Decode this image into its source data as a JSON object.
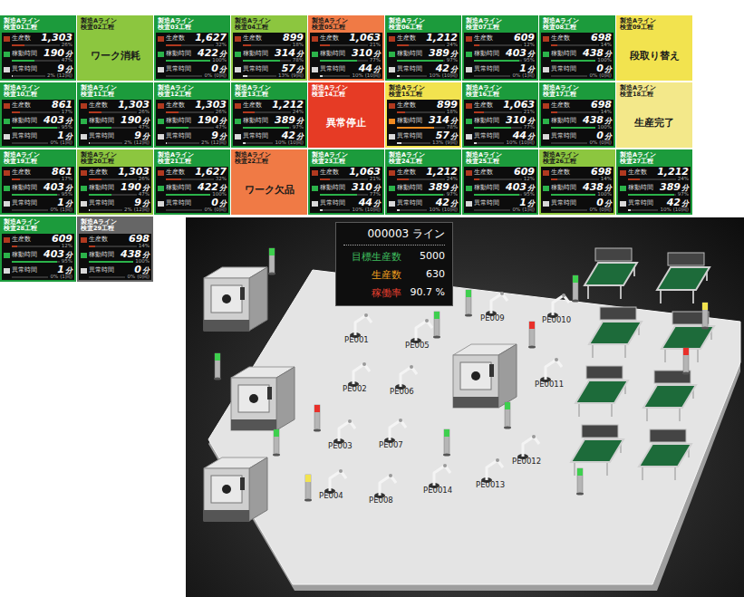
{
  "dashboard": {
    "tiles": [
      {
        "line": "製造Aライン",
        "process": "検査01工程",
        "color": "#1c9b3c",
        "kind": "metrics",
        "rows": [
          {
            "label": "生産数",
            "value": "1,303",
            "pct": "26%",
            "level": 0.26,
            "color": "#b0391f"
          },
          {
            "label": "稼動時間",
            "value": "190",
            "unit": "分",
            "pct": "47%",
            "level": 0.47,
            "color": "#2bb34a"
          },
          {
            "label": "異常時間",
            "value": "9",
            "unit": "分",
            "pct": "2%",
            "level": 0.02,
            "color": "#d8d8d8",
            "count": "(12回)"
          }
        ]
      },
      {
        "line": "製造Aライン",
        "process": "検査02工程",
        "color": "#8cc63f",
        "kind": "status",
        "status": "ワーク消耗"
      },
      {
        "line": "製造Aライン",
        "process": "検査03工程",
        "color": "#1c9b3c",
        "kind": "metrics",
        "rows": [
          {
            "label": "生産数",
            "value": "1,627",
            "pct": "32%",
            "level": 0.32,
            "color": "#b0391f"
          },
          {
            "label": "稼動時間",
            "value": "422",
            "unit": "分",
            "pct": "100%",
            "level": 1,
            "color": "#2bb34a"
          },
          {
            "label": "異常時間",
            "value": "0",
            "unit": "分",
            "pct": "0%",
            "level": 0,
            "color": "#d8d8d8",
            "count": "(0回)"
          }
        ]
      },
      {
        "line": "製造Aライン",
        "process": "検査04工程",
        "color": "#8cc63f",
        "kind": "metrics",
        "rows": [
          {
            "label": "生産数",
            "value": "899",
            "pct": "18%",
            "level": 0.18,
            "color": "#b0391f"
          },
          {
            "label": "稼動時間",
            "value": "314",
            "unit": "分",
            "pct": "78%",
            "level": 0.78,
            "color": "#2bb34a"
          },
          {
            "label": "異常時間",
            "value": "57",
            "unit": "分",
            "pct": "13%",
            "level": 0.13,
            "color": "#d8d8d8",
            "count": "(9回)"
          }
        ]
      },
      {
        "line": "製造Aライン",
        "process": "検査05工程",
        "color": "#f07a45",
        "kind": "metrics",
        "rows": [
          {
            "label": "生産数",
            "value": "1,063",
            "pct": "21%",
            "level": 0.21,
            "color": "#b0391f"
          },
          {
            "label": "稼動時間",
            "value": "310",
            "unit": "分",
            "pct": "77%",
            "level": 0.77,
            "color": "#2bb34a"
          },
          {
            "label": "異常時間",
            "value": "44",
            "unit": "分",
            "pct": "10%",
            "level": 0.1,
            "color": "#d8d8d8",
            "count": "(10回)"
          }
        ]
      },
      {
        "line": "製造Aライン",
        "process": "検査06工程",
        "color": "#1c9b3c",
        "kind": "metrics",
        "rows": [
          {
            "label": "生産数",
            "value": "1,212",
            "pct": "24%",
            "level": 0.24,
            "color": "#b0391f"
          },
          {
            "label": "稼動時間",
            "value": "389",
            "unit": "分",
            "pct": "97%",
            "level": 0.97,
            "color": "#2bb34a"
          },
          {
            "label": "異常時間",
            "value": "42",
            "unit": "分",
            "pct": "10%",
            "level": 0.1,
            "color": "#d8d8d8",
            "count": "(10回)"
          }
        ]
      },
      {
        "line": "製造Aライン",
        "process": "検査07工程",
        "color": "#1c9b3c",
        "kind": "metrics",
        "rows": [
          {
            "label": "生産数",
            "value": "609",
            "pct": "12%",
            "level": 0.12,
            "color": "#b0391f"
          },
          {
            "label": "稼動時間",
            "value": "403",
            "unit": "分",
            "pct": "95%",
            "level": 0.95,
            "color": "#2bb34a"
          },
          {
            "label": "異常時間",
            "value": "1",
            "unit": "分",
            "pct": "0%",
            "level": 0,
            "color": "#d8d8d8",
            "count": "(1回)"
          }
        ]
      },
      {
        "line": "製造Aライン",
        "process": "検査08工程",
        "color": "#1c9b3c",
        "kind": "metrics",
        "rows": [
          {
            "label": "生産数",
            "value": "698",
            "pct": "14%",
            "level": 0.14,
            "color": "#b0391f"
          },
          {
            "label": "稼動時間",
            "value": "438",
            "unit": "分",
            "pct": "100%",
            "level": 1,
            "color": "#2bb34a"
          },
          {
            "label": "異常時間",
            "value": "0",
            "unit": "分",
            "pct": "0%",
            "level": 0,
            "color": "#d8d8d8",
            "count": "(0回)"
          }
        ]
      },
      {
        "line": "製造Aライン",
        "process": "検査09工程",
        "color": "#f2e34f",
        "kind": "status",
        "status": "段取り替え"
      },
      {
        "line": "製造Aライン",
        "process": "検査10工程",
        "color": "#1c9b3c",
        "kind": "metrics",
        "rows": [
          {
            "label": "生産数",
            "value": "861",
            "pct": "17%",
            "level": 0.17,
            "color": "#b0391f"
          },
          {
            "label": "稼動時間",
            "value": "403",
            "unit": "分",
            "pct": "95%",
            "level": 0.95,
            "color": "#2bb34a"
          },
          {
            "label": "異常時間",
            "value": "1",
            "unit": "分",
            "pct": "0%",
            "level": 0,
            "color": "#d8d8d8",
            "count": "(1回)"
          }
        ]
      },
      {
        "line": "製造Aライン",
        "process": "検査11工程",
        "color": "#1c9b3c",
        "kind": "metrics",
        "rows": [
          {
            "label": "生産数",
            "value": "1,303",
            "pct": "26%",
            "level": 0.26,
            "color": "#b0391f"
          },
          {
            "label": "稼動時間",
            "value": "190",
            "unit": "分",
            "pct": "47%",
            "level": 0.47,
            "color": "#2bb34a"
          },
          {
            "label": "異常時間",
            "value": "9",
            "unit": "分",
            "pct": "2%",
            "level": 0.02,
            "color": "#d8d8d8",
            "count": "(12回)"
          }
        ]
      },
      {
        "line": "製造Aライン",
        "process": "検査12工程",
        "color": "#1c9b3c",
        "kind": "metrics",
        "rows": [
          {
            "label": "生産数",
            "value": "1,303",
            "pct": "26%",
            "level": 0.26,
            "color": "#b0391f"
          },
          {
            "label": "稼動時間",
            "value": "190",
            "unit": "分",
            "pct": "47%",
            "level": 0.47,
            "color": "#2bb34a"
          },
          {
            "label": "異常時間",
            "value": "9",
            "unit": "分",
            "pct": "2%",
            "level": 0.02,
            "color": "#d8d8d8",
            "count": "(12回)"
          }
        ]
      },
      {
        "line": "製造Aライン",
        "process": "検査13工程",
        "color": "#1c9b3c",
        "kind": "metrics",
        "rows": [
          {
            "label": "生産数",
            "value": "1,212",
            "pct": "24%",
            "level": 0.24,
            "color": "#b0391f"
          },
          {
            "label": "稼動時間",
            "value": "389",
            "unit": "分",
            "pct": "97%",
            "level": 0.97,
            "color": "#2bb34a"
          },
          {
            "label": "異常時間",
            "value": "42",
            "unit": "分",
            "pct": "10%",
            "level": 0.1,
            "color": "#d8d8d8",
            "count": "(10回)"
          }
        ]
      },
      {
        "line": "製造Aライン",
        "process": "検査14工程",
        "color": "#e63b25",
        "kind": "status",
        "status": "異常停止"
      },
      {
        "line": "製造Aライン",
        "process": "検査15工程",
        "color": "#f2e34f",
        "kind": "metrics",
        "rows": [
          {
            "label": "生産数",
            "value": "899",
            "pct": "18%",
            "level": 0.18,
            "color": "#b0391f"
          },
          {
            "label": "稼動時間",
            "value": "314",
            "unit": "分",
            "pct": "78%",
            "level": 0.78,
            "color": "#f08a20"
          },
          {
            "label": "異常時間",
            "value": "57",
            "unit": "分",
            "pct": "13%",
            "level": 0.13,
            "color": "#d8d8d8",
            "count": "(9回)"
          }
        ]
      },
      {
        "line": "製造Aライン",
        "process": "検査16工程",
        "color": "#1c9b3c",
        "kind": "metrics",
        "rows": [
          {
            "label": "生産数",
            "value": "1,063",
            "pct": "21%",
            "level": 0.21,
            "color": "#b0391f"
          },
          {
            "label": "稼動時間",
            "value": "310",
            "unit": "分",
            "pct": "77%",
            "level": 0.77,
            "color": "#2bb34a"
          },
          {
            "label": "異常時間",
            "value": "44",
            "unit": "分",
            "pct": "10%",
            "level": 0.1,
            "color": "#d8d8d8",
            "count": "(10回)"
          }
        ]
      },
      {
        "line": "製造Aライン",
        "process": "検査17工程",
        "color": "#1c9b3c",
        "kind": "metrics",
        "rows": [
          {
            "label": "生産数",
            "value": "698",
            "pct": "14%",
            "level": 0.14,
            "color": "#b0391f"
          },
          {
            "label": "稼動時間",
            "value": "438",
            "unit": "分",
            "pct": "100%",
            "level": 1,
            "color": "#2bb34a"
          },
          {
            "label": "異常時間",
            "value": "0",
            "unit": "分",
            "pct": "0%",
            "level": 0,
            "color": "#d8d8d8",
            "count": "(0回)"
          }
        ]
      },
      {
        "line": "製造Aライン",
        "process": "検査18工程",
        "color": "#f3e88a",
        "kind": "status",
        "status": "生産完了"
      },
      {
        "line": "製造Aライン",
        "process": "検査19工程",
        "color": "#1c9b3c",
        "kind": "metrics",
        "rows": [
          {
            "label": "生産数",
            "value": "861",
            "pct": "17%",
            "level": 0.17,
            "color": "#b0391f"
          },
          {
            "label": "稼動時間",
            "value": "403",
            "unit": "分",
            "pct": "95%",
            "level": 0.95,
            "color": "#2bb34a"
          },
          {
            "label": "異常時間",
            "value": "1",
            "unit": "分",
            "pct": "0%",
            "level": 0,
            "color": "#d8d8d8",
            "count": "(1回)"
          }
        ]
      },
      {
        "line": "製造Aライン",
        "process": "検査20工程",
        "color": "#8cc63f",
        "kind": "metrics",
        "rows": [
          {
            "label": "生産数",
            "value": "1,303",
            "pct": "26%",
            "level": 0.26,
            "color": "#b0391f"
          },
          {
            "label": "稼動時間",
            "value": "190",
            "unit": "分",
            "pct": "47%",
            "level": 0.47,
            "color": "#2bb34a"
          },
          {
            "label": "異常時間",
            "value": "9",
            "unit": "分",
            "pct": "2%",
            "level": 0.02,
            "color": "#d8d8d8",
            "count": "(12回)"
          }
        ]
      },
      {
        "line": "製造Aライン",
        "process": "検査21工程",
        "color": "#1c9b3c",
        "kind": "metrics",
        "rows": [
          {
            "label": "生産数",
            "value": "1,627",
            "pct": "32%",
            "level": 0.32,
            "color": "#b0391f"
          },
          {
            "label": "稼動時間",
            "value": "422",
            "unit": "分",
            "pct": "100%",
            "level": 1,
            "color": "#2bb34a"
          },
          {
            "label": "異常時間",
            "value": "0",
            "unit": "分",
            "pct": "0%",
            "level": 0,
            "color": "#d8d8d8",
            "count": "(0回)"
          }
        ]
      },
      {
        "line": "製造Aライン",
        "process": "検査22工程",
        "color": "#f07a45",
        "kind": "status",
        "status": "ワーク欠品"
      },
      {
        "line": "製造Aライン",
        "process": "検査23工程",
        "color": "#1c9b3c",
        "kind": "metrics",
        "rows": [
          {
            "label": "生産数",
            "value": "1,063",
            "pct": "21%",
            "level": 0.21,
            "color": "#b0391f"
          },
          {
            "label": "稼動時間",
            "value": "310",
            "unit": "分",
            "pct": "77%",
            "level": 0.77,
            "color": "#2bb34a"
          },
          {
            "label": "異常時間",
            "value": "44",
            "unit": "分",
            "pct": "10%",
            "level": 0.1,
            "color": "#d8d8d8",
            "count": "(10回)"
          }
        ]
      },
      {
        "line": "製造Aライン",
        "process": "検査24工程",
        "color": "#1c9b3c",
        "kind": "metrics",
        "rows": [
          {
            "label": "生産数",
            "value": "1,212",
            "pct": "24%",
            "level": 0.24,
            "color": "#b0391f"
          },
          {
            "label": "稼動時間",
            "value": "389",
            "unit": "分",
            "pct": "97%",
            "level": 0.97,
            "color": "#2bb34a"
          },
          {
            "label": "異常時間",
            "value": "42",
            "unit": "分",
            "pct": "10%",
            "level": 0.1,
            "color": "#d8d8d8",
            "count": "(10回)"
          }
        ]
      },
      {
        "line": "製造Aライン",
        "process": "検査25工程",
        "color": "#1c9b3c",
        "kind": "metrics",
        "rows": [
          {
            "label": "生産数",
            "value": "609",
            "pct": "12%",
            "level": 0.12,
            "color": "#b0391f"
          },
          {
            "label": "稼動時間",
            "value": "403",
            "unit": "分",
            "pct": "95%",
            "level": 0.95,
            "color": "#2bb34a"
          },
          {
            "label": "異常時間",
            "value": "1",
            "unit": "分",
            "pct": "0%",
            "level": 0,
            "color": "#d8d8d8",
            "count": "(1回)"
          }
        ]
      },
      {
        "line": "製造Aライン",
        "process": "検査26工程",
        "color": "#8cc63f",
        "kind": "metrics",
        "rows": [
          {
            "label": "生産数",
            "value": "698",
            "pct": "14%",
            "level": 0.14,
            "color": "#b0391f"
          },
          {
            "label": "稼動時間",
            "value": "438",
            "unit": "分",
            "pct": "100%",
            "level": 1,
            "color": "#2bb34a"
          },
          {
            "label": "異常時間",
            "value": "0",
            "unit": "分",
            "pct": "0%",
            "level": 0,
            "color": "#d8d8d8",
            "count": "(0回)"
          }
        ]
      },
      {
        "line": "製造Aライン",
        "process": "検査27工程",
        "color": "#1c9b3c",
        "kind": "metrics",
        "rows": [
          {
            "label": "生産数",
            "value": "1,212",
            "pct": "24%",
            "level": 0.24,
            "color": "#b0391f"
          },
          {
            "label": "稼動時間",
            "value": "389",
            "unit": "分",
            "pct": "97%",
            "level": 0.97,
            "color": "#2bb34a"
          },
          {
            "label": "異常時間",
            "value": "42",
            "unit": "分",
            "pct": "10%",
            "level": 0.1,
            "color": "#d8d8d8",
            "count": "(10回)"
          }
        ]
      },
      {
        "line": "製造Aライン",
        "process": "検査28工程",
        "color": "#1c9b3c",
        "kind": "metrics",
        "rows": [
          {
            "label": "生産数",
            "value": "609",
            "pct": "12%",
            "level": 0.12,
            "color": "#b0391f"
          },
          {
            "label": "稼動時間",
            "value": "403",
            "unit": "分",
            "pct": "95%",
            "level": 0.95,
            "color": "#2bb34a"
          },
          {
            "label": "異常時間",
            "value": "1",
            "unit": "分",
            "pct": "0%",
            "level": 0,
            "color": "#d8d8d8",
            "count": "(1回)"
          }
        ]
      },
      {
        "line": "製造Aライン",
        "process": "検査29工程",
        "color": "#666666",
        "kind": "metrics",
        "rows": [
          {
            "label": "生産数",
            "value": "698",
            "pct": "14%",
            "level": 0.14,
            "color": "#b0391f"
          },
          {
            "label": "稼動時間",
            "value": "438",
            "unit": "分",
            "pct": "100%",
            "level": 1,
            "color": "#2bb34a"
          },
          {
            "label": "異常時間",
            "value": "0",
            "unit": "分",
            "pct": "0%",
            "level": 0,
            "color": "#d8d8d8",
            "count": "(0回)"
          }
        ]
      }
    ]
  },
  "factory": {
    "info": {
      "title": "000003 ライン",
      "stats": [
        {
          "label": "目標生産数",
          "value": "5000",
          "color": "#3fbf5f"
        },
        {
          "label": "生産数",
          "value": "630",
          "color": "#f0a020"
        },
        {
          "label": "稼働率",
          "value": "90.7 %",
          "color": "#e84030"
        }
      ]
    },
    "robots": [
      {
        "label": "PE001"
      },
      {
        "label": "PE002"
      },
      {
        "label": "PE003"
      },
      {
        "label": "PE004"
      },
      {
        "label": "PE005"
      },
      {
        "label": "PE006"
      },
      {
        "label": "PE007"
      },
      {
        "label": "PE008"
      },
      {
        "label": "PE009"
      },
      {
        "label": "PE0010"
      },
      {
        "label": "PE0011"
      },
      {
        "label": "PE0012"
      },
      {
        "label": "PE0013"
      },
      {
        "label": "PE0014"
      }
    ],
    "towers": [
      {
        "color": "#3ecf4e"
      },
      {
        "color": "#3ecf4e"
      },
      {
        "color": "#3ecf4e"
      },
      {
        "color": "#e8302a"
      },
      {
        "color": "#f2e34f"
      },
      {
        "color": "#3ecf4e"
      },
      {
        "color": "#3ecf4e"
      },
      {
        "color": "#e8302a"
      },
      {
        "color": "#3ecf4e"
      },
      {
        "color": "#3ecf4e"
      },
      {
        "color": "#e8302a"
      },
      {
        "color": "#f2e34f"
      },
      {
        "color": "#3ecf4e"
      },
      {
        "color": "#3ecf4e"
      }
    ]
  }
}
